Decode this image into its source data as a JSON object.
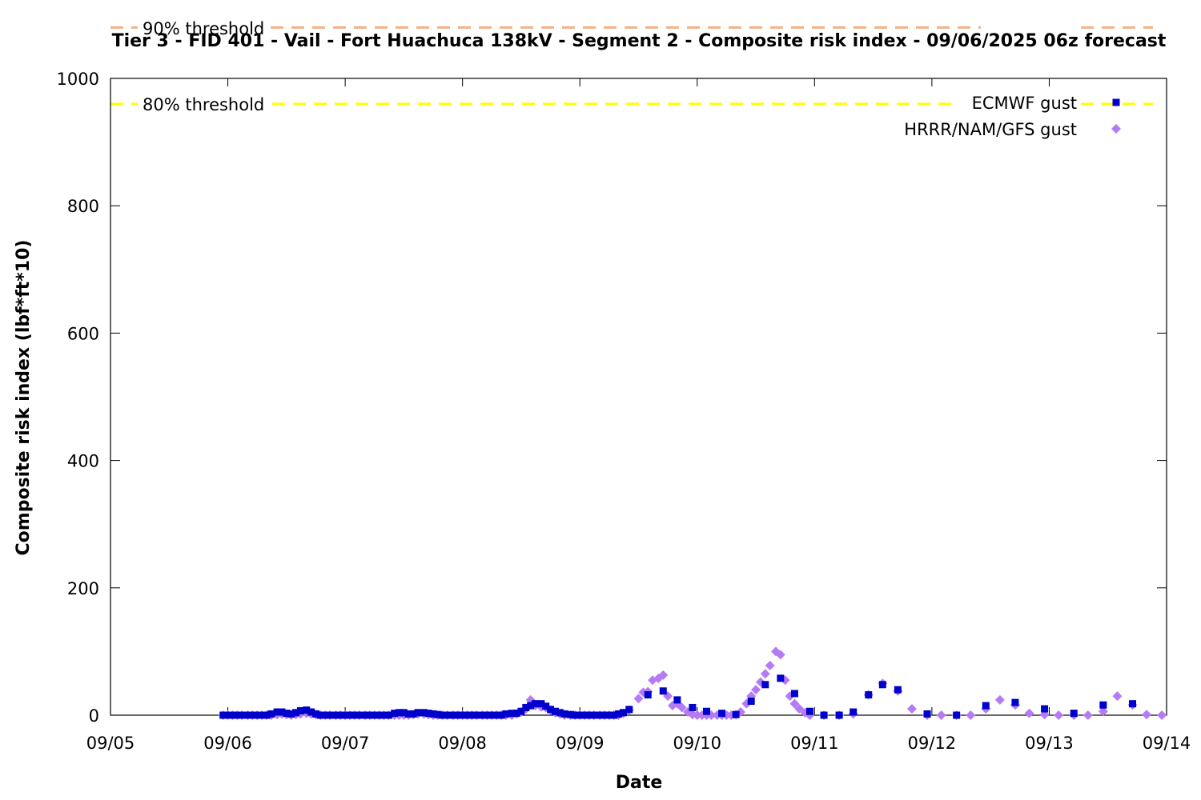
{
  "chart_data": {
    "type": "scatter",
    "title": "Tier 3 - FID 401 - Vail - Fort Huachuca 138kV - Segment 2 - Composite risk index - 09/06/2025 06z forecast",
    "xlabel": "Date",
    "ylabel": "Composite risk index (lbf*ft*10)",
    "x_tick_labels": [
      "09/05",
      "09/06",
      "09/07",
      "09/08",
      "09/09",
      "09/10",
      "09/11",
      "09/12",
      "09/13",
      "09/14"
    ],
    "y_tick_labels": [
      "0",
      "200",
      "400",
      "600",
      "800",
      "1000"
    ],
    "xlim_days": [
      0,
      9
    ],
    "ylim": [
      0,
      1000
    ],
    "grid": false,
    "legend_placement": "top-right",
    "threshold_lines": [
      {
        "name": "90% threshold",
        "value": 1080,
        "color": "#f4b183"
      },
      {
        "name": "80% threshold",
        "value": 960,
        "color": "#ffff00"
      }
    ],
    "series": [
      {
        "name": "ECMWF gust",
        "marker": "square",
        "color": "#0000cc",
        "points": [
          [
            0.96,
            0
          ],
          [
            1.0,
            0
          ],
          [
            1.04,
            0
          ],
          [
            1.08,
            0
          ],
          [
            1.12,
            0
          ],
          [
            1.17,
            0
          ],
          [
            1.21,
            0
          ],
          [
            1.25,
            0
          ],
          [
            1.29,
            0
          ],
          [
            1.33,
            0
          ],
          [
            1.37,
            2
          ],
          [
            1.42,
            5
          ],
          [
            1.46,
            5
          ],
          [
            1.5,
            3
          ],
          [
            1.54,
            2
          ],
          [
            1.58,
            4
          ],
          [
            1.62,
            7
          ],
          [
            1.67,
            8
          ],
          [
            1.71,
            5
          ],
          [
            1.75,
            2
          ],
          [
            1.79,
            0
          ],
          [
            1.83,
            0
          ],
          [
            1.87,
            0
          ],
          [
            1.92,
            0
          ],
          [
            1.96,
            0
          ],
          [
            2.0,
            0
          ],
          [
            2.04,
            0
          ],
          [
            2.08,
            0
          ],
          [
            2.12,
            0
          ],
          [
            2.17,
            0
          ],
          [
            2.21,
            0
          ],
          [
            2.25,
            0
          ],
          [
            2.29,
            0
          ],
          [
            2.33,
            0
          ],
          [
            2.37,
            0
          ],
          [
            2.42,
            3
          ],
          [
            2.46,
            4
          ],
          [
            2.5,
            4
          ],
          [
            2.54,
            2
          ],
          [
            2.58,
            2
          ],
          [
            2.62,
            4
          ],
          [
            2.67,
            4
          ],
          [
            2.71,
            3
          ],
          [
            2.75,
            2
          ],
          [
            2.79,
            1
          ],
          [
            2.83,
            0
          ],
          [
            2.87,
            0
          ],
          [
            2.92,
            0
          ],
          [
            2.96,
            0
          ],
          [
            3.0,
            0
          ],
          [
            3.04,
            0
          ],
          [
            3.08,
            0
          ],
          [
            3.12,
            0
          ],
          [
            3.17,
            0
          ],
          [
            3.21,
            0
          ],
          [
            3.25,
            0
          ],
          [
            3.29,
            0
          ],
          [
            3.33,
            0
          ],
          [
            3.37,
            2
          ],
          [
            3.42,
            3
          ],
          [
            3.46,
            3
          ],
          [
            3.5,
            6
          ],
          [
            3.54,
            12
          ],
          [
            3.58,
            15
          ],
          [
            3.62,
            18
          ],
          [
            3.67,
            18
          ],
          [
            3.71,
            14
          ],
          [
            3.75,
            9
          ],
          [
            3.79,
            6
          ],
          [
            3.83,
            4
          ],
          [
            3.87,
            2
          ],
          [
            3.92,
            1
          ],
          [
            3.96,
            0
          ],
          [
            4.0,
            0
          ],
          [
            4.04,
            0
          ],
          [
            4.08,
            0
          ],
          [
            4.12,
            0
          ],
          [
            4.17,
            0
          ],
          [
            4.21,
            0
          ],
          [
            4.25,
            0
          ],
          [
            4.29,
            0
          ],
          [
            4.33,
            2
          ],
          [
            4.37,
            4
          ],
          [
            4.42,
            9
          ],
          [
            4.58,
            32
          ],
          [
            4.71,
            38
          ],
          [
            4.83,
            24
          ],
          [
            4.96,
            12
          ],
          [
            5.08,
            6
          ],
          [
            5.21,
            3
          ],
          [
            5.33,
            1
          ],
          [
            5.46,
            22
          ],
          [
            5.58,
            48
          ],
          [
            5.71,
            58
          ],
          [
            5.83,
            34
          ],
          [
            5.96,
            6
          ],
          [
            6.08,
            0
          ],
          [
            6.21,
            0
          ],
          [
            6.33,
            5
          ],
          [
            6.46,
            32
          ],
          [
            6.58,
            48
          ],
          [
            6.71,
            40
          ],
          [
            6.96,
            2
          ],
          [
            7.21,
            0
          ],
          [
            7.46,
            15
          ],
          [
            7.71,
            20
          ],
          [
            7.96,
            10
          ],
          [
            8.21,
            3
          ],
          [
            8.46,
            16
          ],
          [
            8.71,
            18
          ]
        ]
      },
      {
        "name": "HRRR/NAM/GFS gust",
        "marker": "diamond",
        "color": "#b57bf5",
        "points": [
          [
            0.96,
            0
          ],
          [
            1.0,
            0
          ],
          [
            1.04,
            0
          ],
          [
            1.08,
            0
          ],
          [
            1.12,
            0
          ],
          [
            1.17,
            0
          ],
          [
            1.21,
            0
          ],
          [
            1.25,
            0
          ],
          [
            1.29,
            0
          ],
          [
            1.33,
            0
          ],
          [
            1.37,
            0
          ],
          [
            1.42,
            1
          ],
          [
            1.46,
            2
          ],
          [
            1.5,
            1
          ],
          [
            1.54,
            0
          ],
          [
            1.58,
            1
          ],
          [
            1.62,
            2
          ],
          [
            1.67,
            3
          ],
          [
            1.71,
            2
          ],
          [
            1.75,
            1
          ],
          [
            1.79,
            0
          ],
          [
            1.83,
            0
          ],
          [
            1.87,
            0
          ],
          [
            1.92,
            0
          ],
          [
            1.96,
            0
          ],
          [
            2.0,
            0
          ],
          [
            2.04,
            0
          ],
          [
            2.08,
            0
          ],
          [
            2.12,
            0
          ],
          [
            2.17,
            0
          ],
          [
            2.21,
            0
          ],
          [
            2.25,
            0
          ],
          [
            2.29,
            0
          ],
          [
            2.33,
            0
          ],
          [
            2.37,
            0
          ],
          [
            2.42,
            0
          ],
          [
            2.46,
            0
          ],
          [
            2.5,
            0
          ],
          [
            2.54,
            0
          ],
          [
            2.58,
            1
          ],
          [
            2.62,
            2
          ],
          [
            2.67,
            2
          ],
          [
            2.71,
            1
          ],
          [
            2.75,
            0
          ],
          [
            2.79,
            0
          ],
          [
            2.83,
            0
          ],
          [
            2.87,
            0
          ],
          [
            2.92,
            0
          ],
          [
            2.96,
            0
          ],
          [
            3.0,
            0
          ],
          [
            3.04,
            0
          ],
          [
            3.08,
            0
          ],
          [
            3.12,
            0
          ],
          [
            3.17,
            0
          ],
          [
            3.21,
            0
          ],
          [
            3.25,
            0
          ],
          [
            3.29,
            0
          ],
          [
            3.33,
            0
          ],
          [
            3.37,
            0
          ],
          [
            3.42,
            0
          ],
          [
            3.46,
            2
          ],
          [
            3.5,
            5
          ],
          [
            3.54,
            10
          ],
          [
            3.58,
            24
          ],
          [
            3.62,
            15
          ],
          [
            3.67,
            13
          ],
          [
            3.71,
            12
          ],
          [
            3.75,
            8
          ],
          [
            3.79,
            4
          ],
          [
            3.83,
            2
          ],
          [
            3.87,
            0
          ],
          [
            3.92,
            0
          ],
          [
            3.96,
            0
          ],
          [
            4.0,
            0
          ],
          [
            4.04,
            0
          ],
          [
            4.08,
            0
          ],
          [
            4.12,
            0
          ],
          [
            4.17,
            0
          ],
          [
            4.21,
            0
          ],
          [
            4.25,
            0
          ],
          [
            4.29,
            0
          ],
          [
            4.33,
            0
          ],
          [
            4.37,
            3
          ],
          [
            4.42,
            8
          ],
          [
            4.5,
            26
          ],
          [
            4.54,
            36
          ],
          [
            4.58,
            37
          ],
          [
            4.62,
            55
          ],
          [
            4.67,
            58
          ],
          [
            4.71,
            63
          ],
          [
            4.75,
            30
          ],
          [
            4.79,
            15
          ],
          [
            4.83,
            18
          ],
          [
            4.87,
            12
          ],
          [
            4.92,
            5
          ],
          [
            4.96,
            1
          ],
          [
            5.0,
            0
          ],
          [
            5.04,
            0
          ],
          [
            5.08,
            0
          ],
          [
            5.12,
            0
          ],
          [
            5.17,
            0
          ],
          [
            5.21,
            0
          ],
          [
            5.25,
            0
          ],
          [
            5.29,
            0
          ],
          [
            5.33,
            1
          ],
          [
            5.37,
            5
          ],
          [
            5.42,
            18
          ],
          [
            5.46,
            30
          ],
          [
            5.5,
            40
          ],
          [
            5.54,
            52
          ],
          [
            5.58,
            65
          ],
          [
            5.62,
            78
          ],
          [
            5.67,
            100
          ],
          [
            5.71,
            95
          ],
          [
            5.75,
            55
          ],
          [
            5.79,
            30
          ],
          [
            5.83,
            18
          ],
          [
            5.87,
            10
          ],
          [
            5.92,
            4
          ],
          [
            5.96,
            0
          ],
          [
            6.08,
            0
          ],
          [
            6.21,
            0
          ],
          [
            6.33,
            2
          ],
          [
            6.46,
            32
          ],
          [
            6.58,
            50
          ],
          [
            6.71,
            38
          ],
          [
            6.83,
            10
          ],
          [
            6.96,
            0
          ],
          [
            7.08,
            0
          ],
          [
            7.21,
            0
          ],
          [
            7.33,
            0
          ],
          [
            7.46,
            10
          ],
          [
            7.58,
            24
          ],
          [
            7.71,
            16
          ],
          [
            7.83,
            3
          ],
          [
            7.96,
            1
          ],
          [
            8.08,
            0
          ],
          [
            8.21,
            0
          ],
          [
            8.33,
            0
          ],
          [
            8.46,
            6
          ],
          [
            8.58,
            30
          ],
          [
            8.71,
            16
          ],
          [
            8.83,
            1
          ],
          [
            8.96,
            0
          ]
        ]
      }
    ]
  }
}
